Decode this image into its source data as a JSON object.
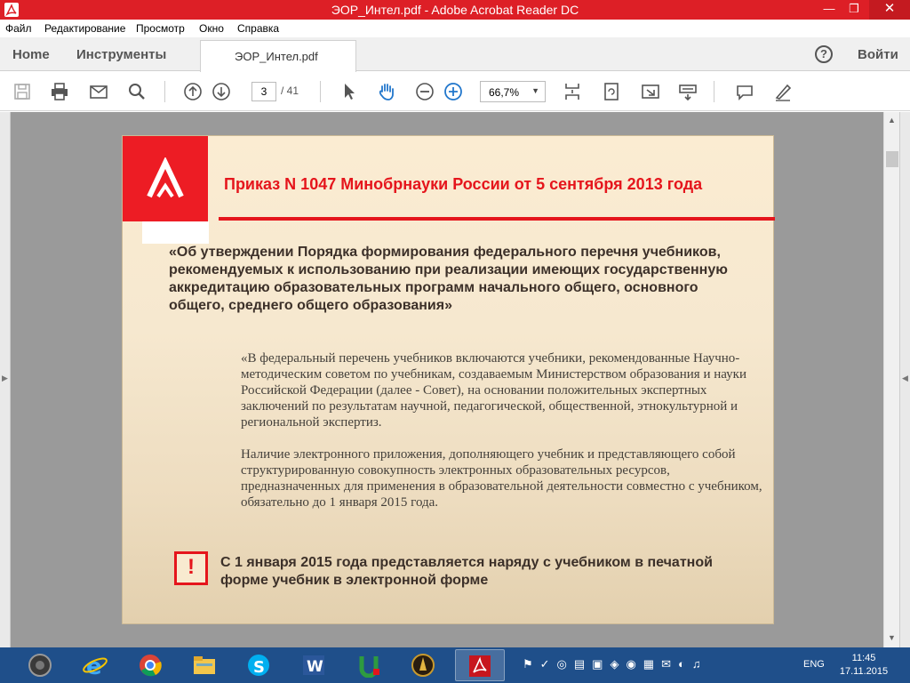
{
  "window": {
    "title": "ЭОР_Интел.pdf - Adobe Acrobat Reader DC",
    "minimize_glyph": "—",
    "maximize_glyph": "❐",
    "close_glyph": "✕"
  },
  "menu": [
    "Файл",
    "Редактирование",
    "Просмотр",
    "Окно",
    "Справка"
  ],
  "tabs": {
    "home": "Home",
    "tools": "Инструменты",
    "document": "ЭОР_Интел.pdf",
    "help": "?",
    "signin": "Войти"
  },
  "toolbar": {
    "icons": [
      "save-icon",
      "print-icon",
      "email-icon",
      "search-icon",
      "prev-page-icon",
      "next-page-icon",
      "select-cursor-icon",
      "hand-icon",
      "zoom-out-icon",
      "zoom-in-icon",
      "fit-page-icon",
      "rotate-icon",
      "fullscreen-icon",
      "keyboard-icon",
      "comment-icon",
      "sign-icon"
    ],
    "page_current": "3",
    "page_total": "/ 41",
    "zoom": "66,7%",
    "zoom_chevron": "▼"
  },
  "slide": {
    "title": "Приказ N 1047 Минобрнауки России от 5 сентября 2013 года",
    "order_title": "«Об утверждении Порядка формирования федерального перечня учебников, рекомендуемых к использованию при реализации имеющих государственную аккредитацию образовательных программ начального общего, основного общего, среднего общего образования»",
    "quote_p1": "«В федеральный перечень учебников включаются учебники, рекомендованные Научно-методическим советом по учебникам, создаваемым Министерством образования и науки Российской Федерации (далее - Совет), на основании положительных экспертных заключений по результатам научной, педагогической, общественной, этнокультурной и региональной экспертиз.",
    "quote_p2": "Наличие электронного приложения, дополняющего учебник и представляющего собой структурированную совокупность электронных образовательных ресурсов, предназначенных для применения в образовательной деятельности совместно с учебником, обязательно до 1 января 2015 года.",
    "alert_symbol": "!",
    "alert_text": "С 1 января 2015 года представляется наряду с учебником в печатной форме учебник в электронной форме"
  },
  "colors": {
    "titlebar": "#dd1f26",
    "accent_red": "#e5151c",
    "taskbar": "#1f4f8a"
  },
  "taskbar": {
    "apps": [
      "sound-recorder",
      "internet-explorer",
      "chrome",
      "file-explorer",
      "skype",
      "word",
      "app-u",
      "app-gold",
      "acrobat-reader"
    ],
    "tray_icons": "⚑✓◎▤▣◈◉▦✉◐♫",
    "language": "ENG",
    "time": "11:45",
    "date": "17.11.2015"
  }
}
